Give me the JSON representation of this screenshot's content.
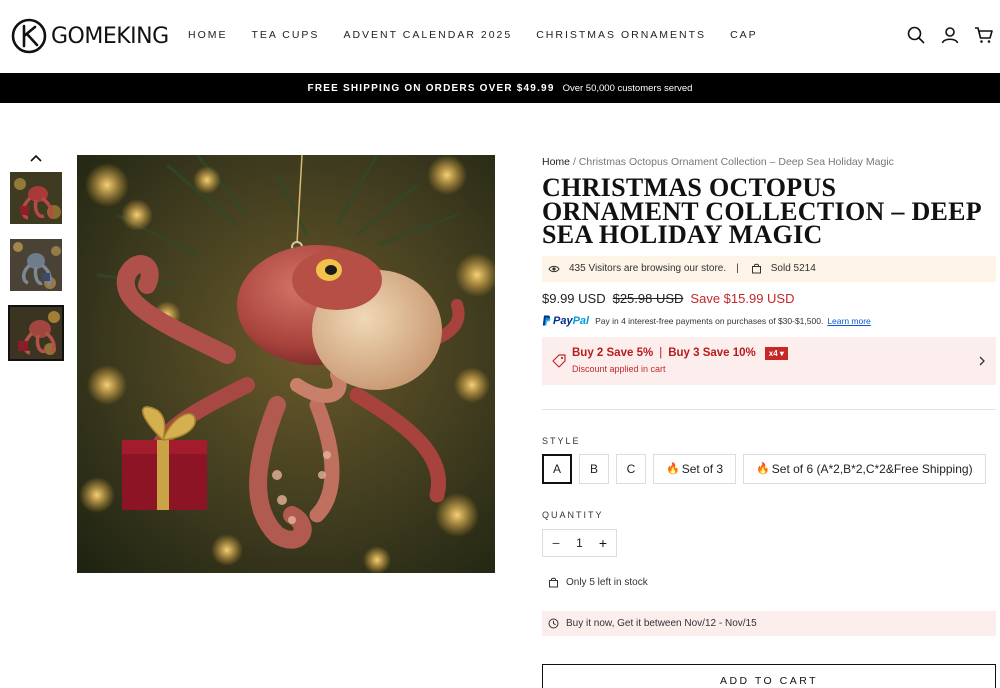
{
  "brand": {
    "name": "GOMEKING"
  },
  "nav": [
    "HOME",
    "TEA CUPS",
    "ADVENT CALENDAR 2025",
    "CHRISTMAS ORNAMENTS",
    "CAP"
  ],
  "header_icons": [
    "search-icon",
    "account-icon",
    "cart-icon"
  ],
  "announcement": {
    "strong": "FREE SHIPPING ON ORDERS OVER $49.99",
    "small": "Over 50,000 customers served"
  },
  "breadcrumb": {
    "home": "Home",
    "separator": "/",
    "current": "Christmas Octopus Ornament Collection – Deep Sea Holiday Magic"
  },
  "product": {
    "title": "Christmas Octopus Ornament Collection – Deep Sea Holiday Magic",
    "visitors": "435 Visitors are browsing our store.",
    "visitors_sep": "|",
    "sold": "Sold 5214",
    "price": "$9.99 USD",
    "compare_price": "$25.98 USD",
    "save": "Save $15.99 USD"
  },
  "paypal": {
    "logo_pay": "Pay",
    "logo_pal": "Pal",
    "text": "Pay in 4 interest-free payments on purchases of $30-$1,500.",
    "link": "Learn more"
  },
  "promo": {
    "offer1": "Buy 2 Save 5%",
    "divider": "|",
    "offer2": "Buy 3 Save 10%",
    "badge": "x4 ▾",
    "note": "Discount applied in cart"
  },
  "style": {
    "label": "STYLE",
    "options": [
      "A",
      "B",
      "C",
      "Set of 3",
      "Set of 6 (A*2,B*2,C*2&Free Shipping)"
    ],
    "selected": "A"
  },
  "quantity": {
    "label": "QUANTITY",
    "minus": "−",
    "value": "1",
    "plus": "+"
  },
  "stock": "Only 5 left in stock",
  "delivery": "Buy it now, Get it between Nov/12 - Nov/15",
  "add_to_cart": "ADD TO CART",
  "colors": {
    "accent_red": "#c1272d",
    "promo_bg": "#fdeeee",
    "visitors_bg": "#fdf3e7",
    "announce_bg": "#000000"
  }
}
